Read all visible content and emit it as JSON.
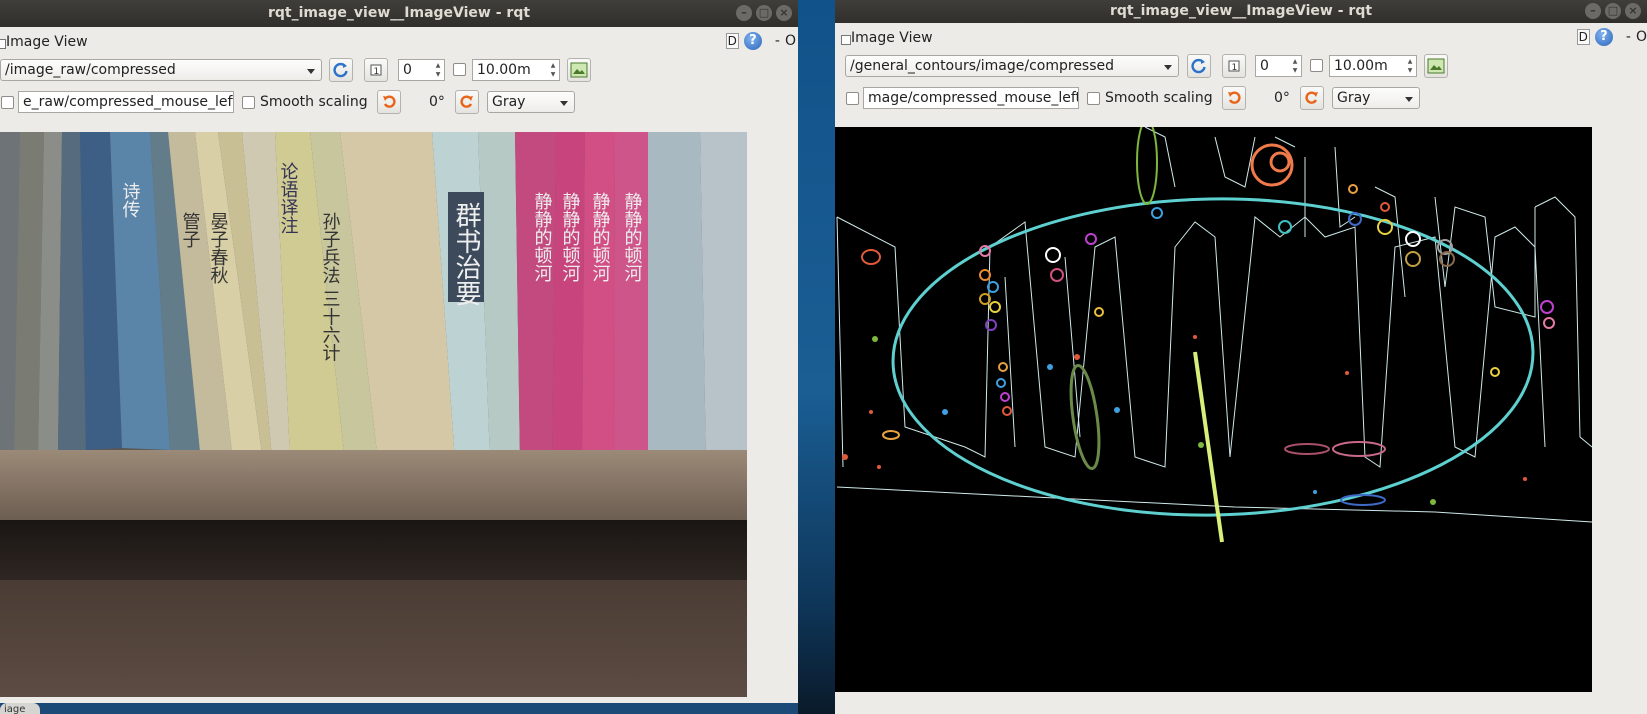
{
  "left_window": {
    "title": "rqt_image_view__ImageView - rqt",
    "panel_title": "Image View",
    "help_box": "D",
    "dash": "-",
    "o": "O",
    "topic": "/image_raw/compressed",
    "spin_value": "0",
    "rate_value": "10.00m",
    "mouse_topic": "e_raw/compressed_mouse_left",
    "smooth_label": "Smooth scaling",
    "rotation": "0°",
    "color_scheme": "Gray"
  },
  "right_window": {
    "title": "rqt_image_view__ImageView - rqt",
    "panel_title": "Image View",
    "help_box": "D",
    "dash": "-",
    "o": "O",
    "topic": "/general_contours/image/compressed",
    "spin_value": "0",
    "rate_value": "10.00m",
    "mouse_topic": "mage/compressed_mouse_left",
    "smooth_label": "Smooth scaling",
    "rotation": "0°",
    "color_scheme": "Gray"
  },
  "bottom_tab": "iage",
  "left_image": {
    "book_titles": [
      "诗传",
      "管子",
      "晏子春秋",
      "论语译注",
      "孙子兵法 三十六计",
      "群书治要",
      "静静的顿河",
      "静静的顿河",
      "静静的顿河",
      "静静的顿河"
    ]
  },
  "colors": {
    "title_bg": "#3a3935",
    "window_bg": "#ecebe8",
    "ellipse": "#5fd0d0",
    "refresh_blue": "#2b72c8",
    "rotate_orange": "#e8641a"
  }
}
